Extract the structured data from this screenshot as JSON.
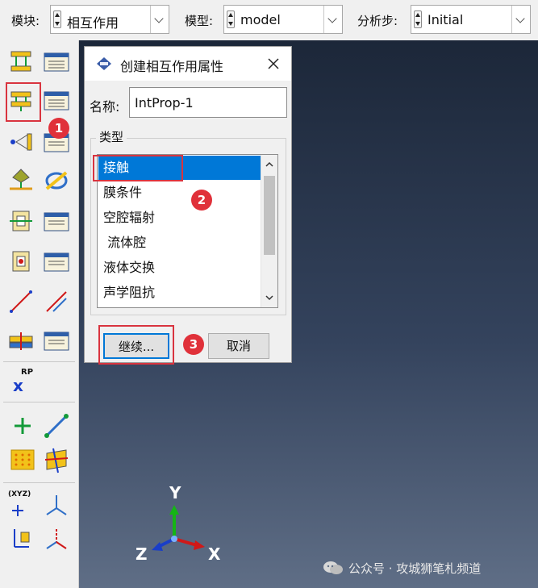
{
  "toolbar": {
    "module_label": "模块:",
    "module_value": "相互作用",
    "model_label": "模型:",
    "model_value": "model",
    "step_label": "分析步:",
    "step_value": "Initial"
  },
  "toolbox": {
    "tools": [
      "interaction-create-icon",
      "interaction-manager-icon",
      "interaction-property-create-icon",
      "interaction-property-manager-icon",
      "contact-controls-icon",
      "contact-controls-manager-icon",
      "contact-initialization-icon",
      "contact-stabilization-icon",
      "constraint-create-icon",
      "constraint-manager-icon",
      "connector-section-create-icon",
      "connector-section-manager-icon",
      "wire-create-icon",
      "connector-assign-icon",
      "fastener-create-icon",
      "fastener-manager-icon",
      "reference-point-icon",
      "point-create-icon",
      "datum-axis-icon",
      "datum-plane-grid-icon",
      "partition-icon",
      "datum-csys-icon",
      "datum-csys-create-icon",
      "datum-triad-icon",
      "query-point-icon"
    ],
    "rp_label": "RP",
    "xyz_label": "(XYZ)"
  },
  "dialog": {
    "title": "创建相互作用属性",
    "name_label": "名称:",
    "name_value": "IntProp-1",
    "type_legend": "类型",
    "types": [
      "接触",
      "膜条件",
      "空腔辐射",
      " 流体腔",
      "液体交换",
      "声学阻抗"
    ],
    "selected_index": 0,
    "continue_label": "继续...",
    "cancel_label": "取消"
  },
  "viewport": {
    "triad": {
      "x": "X",
      "y": "Y",
      "z": "Z"
    },
    "watermark": "公众号 · 攻城狮笔札频道"
  },
  "annotations": {
    "badge1": "1",
    "badge2": "2",
    "badge3": "3"
  },
  "colors": {
    "selection": "#0078d7",
    "annotation_red": "#d9343f",
    "viewport_top": "#1c2739",
    "viewport_bottom": "#5f6e86",
    "axis_x": "#d01818",
    "axis_y": "#15b515",
    "axis_z": "#1a3ec8"
  }
}
